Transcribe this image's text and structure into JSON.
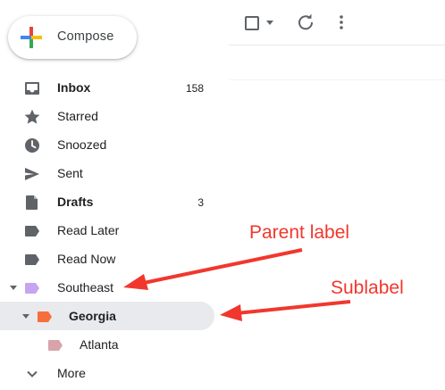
{
  "compose": {
    "label": "Compose"
  },
  "nav": {
    "inbox": {
      "label": "Inbox",
      "count": "158"
    },
    "starred": {
      "label": "Starred"
    },
    "snoozed": {
      "label": "Snoozed"
    },
    "sent": {
      "label": "Sent"
    },
    "drafts": {
      "label": "Drafts",
      "count": "3"
    },
    "read_later": {
      "label": "Read Later"
    },
    "read_now": {
      "label": "Read Now"
    },
    "southeast": {
      "label": "Southeast",
      "color": "#c5a5f0"
    },
    "georgia": {
      "label": "Georgia",
      "color": "#f66e3c"
    },
    "atlanta": {
      "label": "Atlanta",
      "color": "#d9a3ab"
    },
    "more": {
      "label": "More"
    }
  },
  "annotations": {
    "parent_label": "Parent label",
    "sublabel": "Sublabel",
    "color": "#f1372d"
  },
  "icons": {
    "toolbar": [
      "select-checkbox-icon",
      "select-dropdown-icon",
      "refresh-icon",
      "more-vert-icon"
    ]
  }
}
